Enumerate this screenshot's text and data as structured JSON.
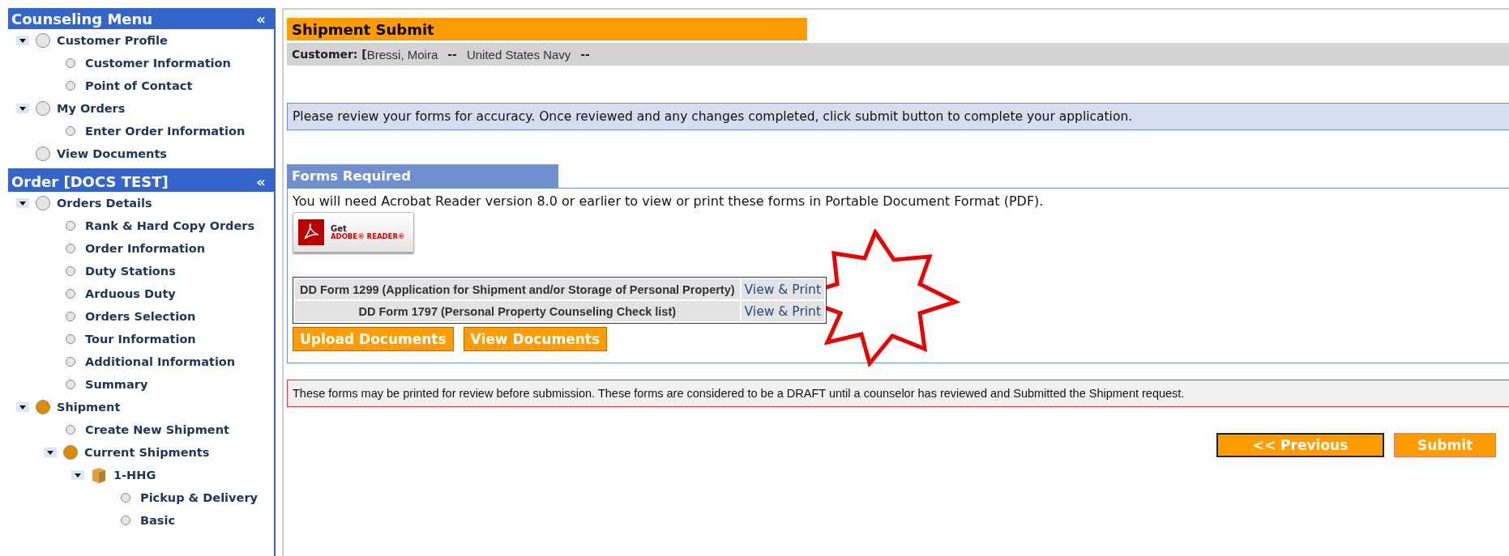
{
  "sidebar": [
    {
      "title": "Counseling Menu",
      "collapse_icon": "«",
      "items": [
        {
          "label": "Customer Profile",
          "kind": "group",
          "active": false,
          "expanded": true,
          "children": [
            {
              "label": "Customer Information",
              "kind": "page"
            },
            {
              "label": "Point of Contact",
              "kind": "page"
            }
          ]
        },
        {
          "label": "My Orders",
          "kind": "group",
          "active": false,
          "expanded": true,
          "children": [
            {
              "label": "Enter Order Information",
              "kind": "page"
            }
          ]
        },
        {
          "label": "View Documents",
          "kind": "group",
          "active": false
        }
      ]
    },
    {
      "title": "Order [DOCS TEST]",
      "collapse_icon": "«",
      "items": [
        {
          "label": "Orders Details",
          "kind": "group",
          "active": false,
          "expanded": true,
          "children": [
            {
              "label": "Rank & Hard Copy Orders",
              "kind": "page"
            },
            {
              "label": "Order Information",
              "kind": "page"
            },
            {
              "label": "Duty Stations",
              "kind": "page"
            },
            {
              "label": "Arduous Duty",
              "kind": "page"
            },
            {
              "label": "Orders Selection",
              "kind": "page"
            },
            {
              "label": "Tour Information",
              "kind": "page"
            },
            {
              "label": "Additional Information",
              "kind": "page"
            },
            {
              "label": "Summary",
              "kind": "page"
            }
          ]
        },
        {
          "label": "Shipment",
          "kind": "group",
          "active": true,
          "expanded": true,
          "children": [
            {
              "label": "Create New Shipment",
              "kind": "page"
            },
            {
              "label": "Current Shipments",
              "kind": "group",
              "active": true,
              "expanded": true,
              "children": [
                {
                  "label": "1-HHG",
                  "kind": "package",
                  "expanded": true,
                  "children": [
                    {
                      "label": "Pickup & Delivery",
                      "kind": "page"
                    },
                    {
                      "label": "Basic",
                      "kind": "page"
                    }
                  ]
                }
              ]
            }
          ]
        }
      ]
    }
  ],
  "page_title": "Shipment Submit",
  "customer": {
    "label": "Customer: [",
    "name": "Bressi, Moira",
    "sep1": "--",
    "branch": "United States Navy",
    "sep2": "--"
  },
  "info": "Please review your forms for accuracy. Once reviewed and any changes completed, click submit button to complete your application.",
  "forms": {
    "title": "Forms Required",
    "note": "You will need Acrobat Reader version 8.0 or earlier to view or print these forms in Portable Document Format (PDF).",
    "adobe": {
      "get": "Get",
      "brand": "ADOBE® READER®"
    },
    "rows": [
      {
        "name": "DD Form 1299 (Application for Shipment and/or Storage of Personal Property)",
        "link": "View & Print"
      },
      {
        "name": "DD Form 1797 (Personal Property Counseling Check list)",
        "link": "View & Print"
      }
    ],
    "buttons": [
      "Upload Documents",
      "View Documents"
    ]
  },
  "warning": "These forms may be printed for review before submission. These forms are considered to be a DRAFT until a counselor has reviewed and Submitted the Shipment request.",
  "nav_buttons": [
    {
      "label": "<< Previous",
      "kind": "outlined"
    },
    {
      "label": "Submit",
      "kind": "plain"
    }
  ]
}
